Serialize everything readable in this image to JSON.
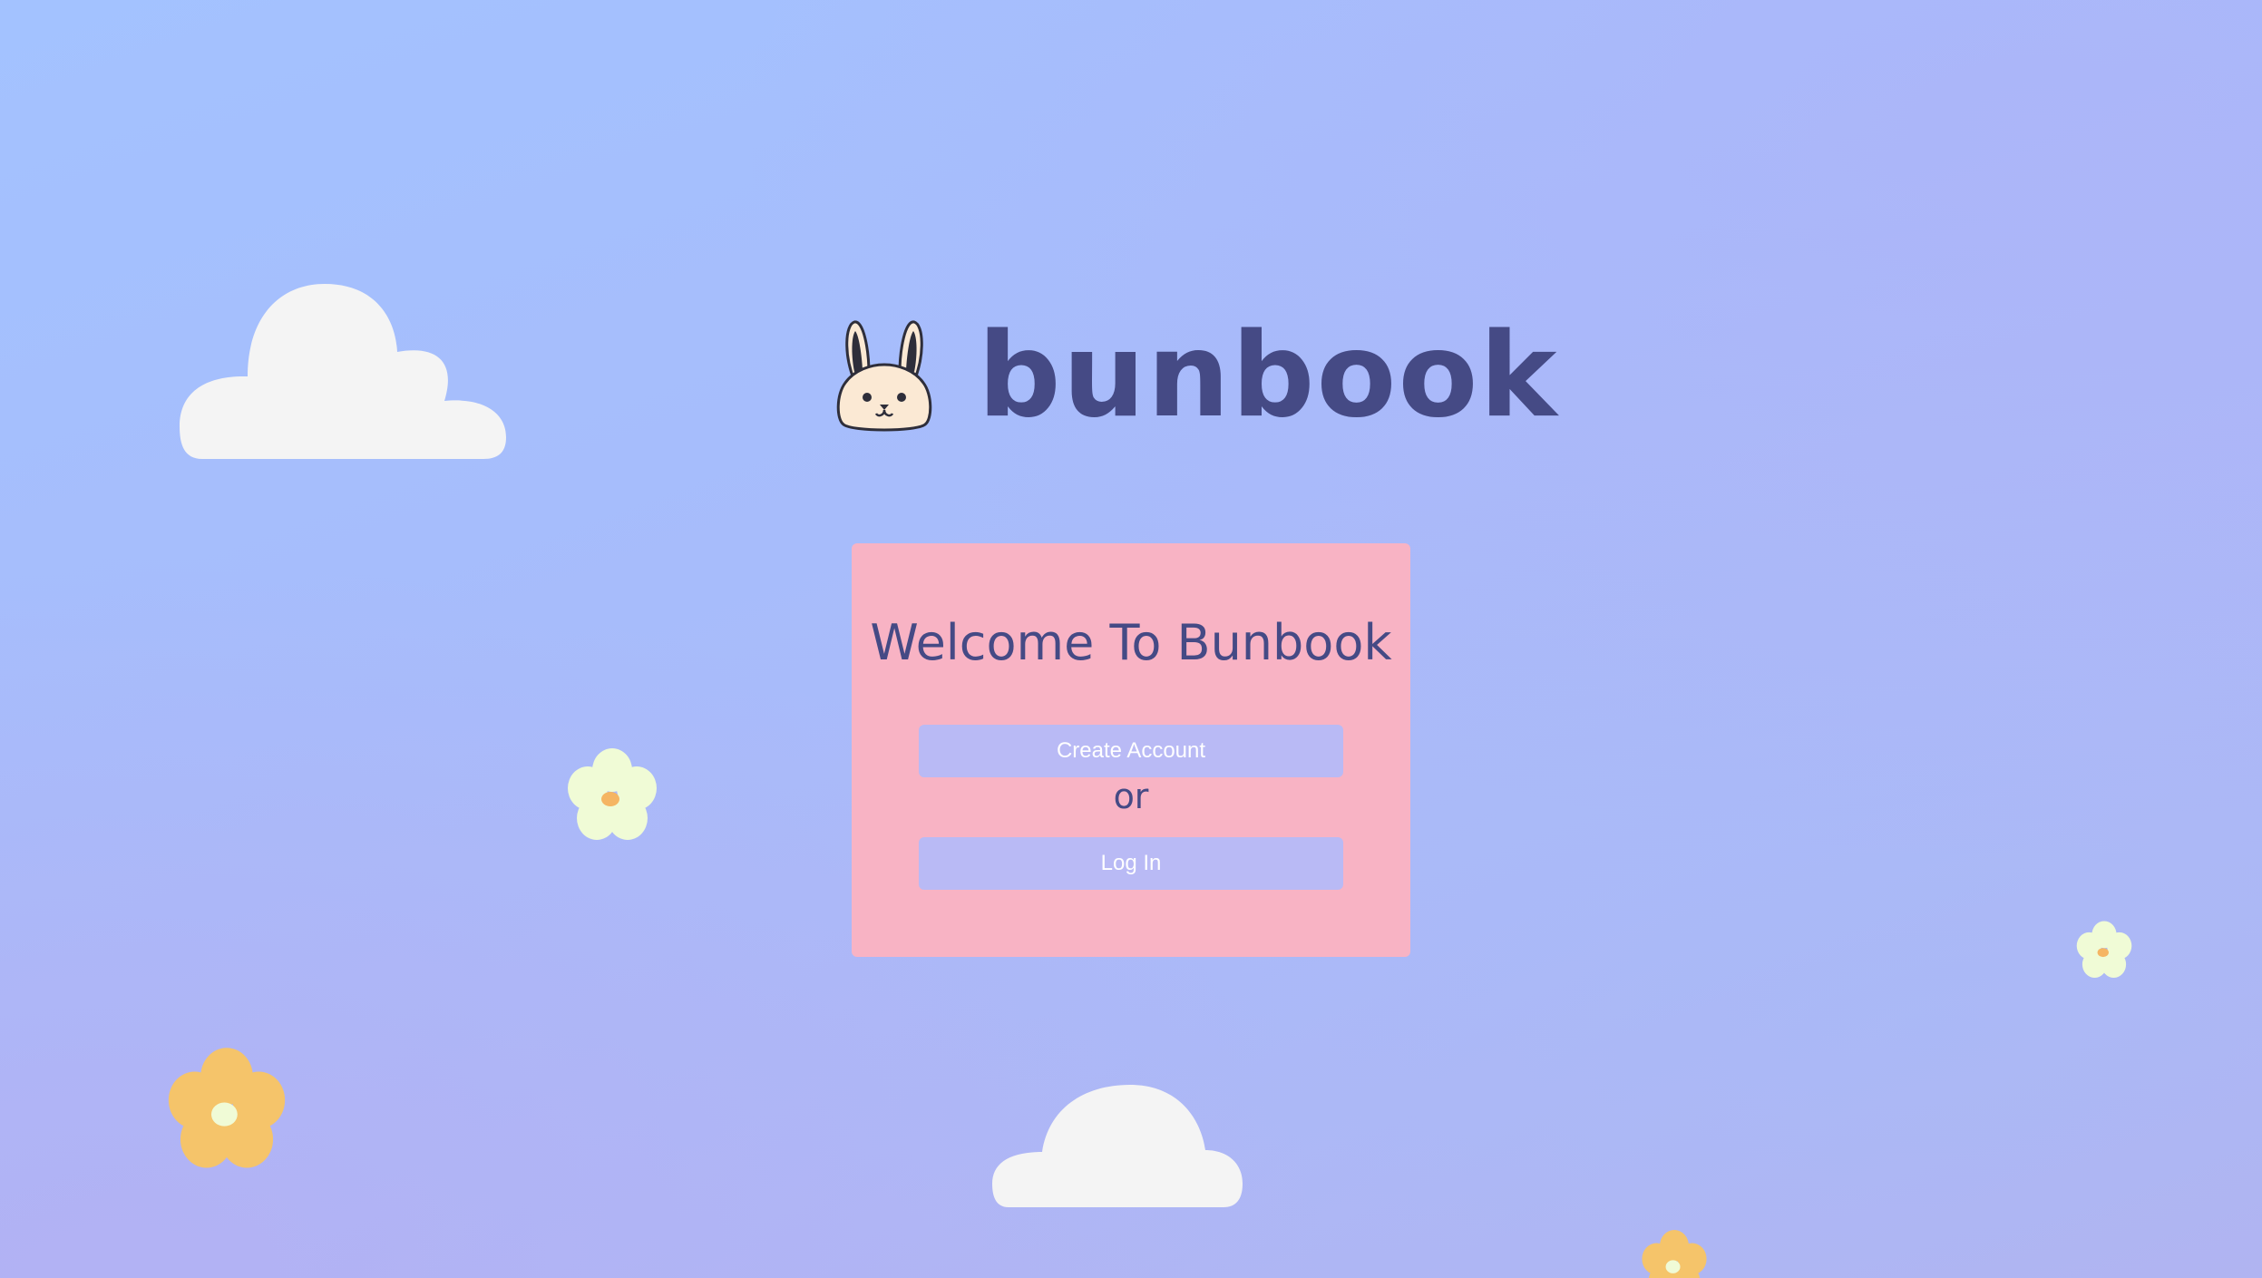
{
  "app": {
    "brand_name": "bunbook",
    "logo_icon": "bunny-icon"
  },
  "welcome_card": {
    "title": "Welcome To Bunbook",
    "create_account_label": "Create Account",
    "separator_text": "or",
    "login_label": "Log In"
  },
  "decorations": {
    "icons": [
      "cloud-icon",
      "cloud-icon",
      "flower-icon",
      "flower-icon",
      "flower-icon",
      "flower-icon"
    ]
  },
  "colors": {
    "background_top": "#a3c2ff",
    "background_bottom": "#b4b2ef",
    "card": "#f8b3c4",
    "button": "#b9baf5",
    "text_dark": "#454a85",
    "cloud": "#f4f4f4",
    "flower_yellow": "#f5c46a",
    "flower_pale": "#f0fbd6"
  }
}
